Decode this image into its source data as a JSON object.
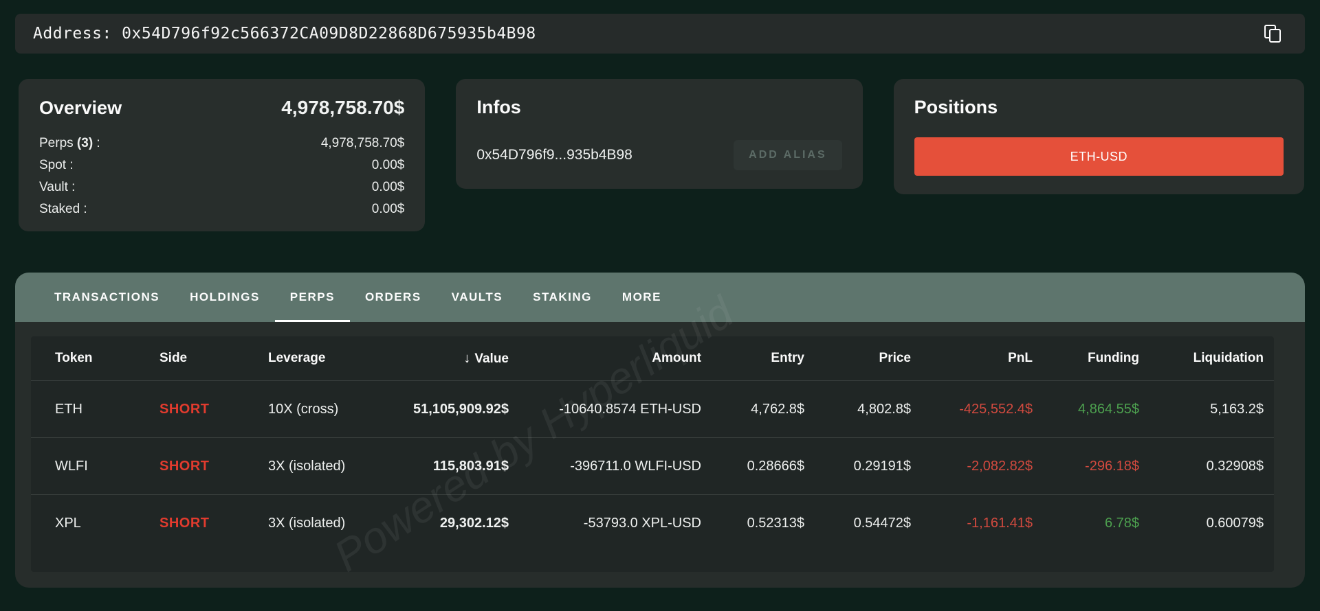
{
  "address_bar": {
    "text": "Address: 0x54D796f92c566372CA09D8D22868D675935b4B98"
  },
  "overview": {
    "title": "Overview",
    "total": "4,978,758.70$",
    "rows": [
      {
        "label": "Perps",
        "badge": "(3)",
        "suffix": " :",
        "value": "4,978,758.70$"
      },
      {
        "label": "Spot",
        "badge": "",
        "suffix": " :",
        "value": "0.00$"
      },
      {
        "label": "Vault",
        "badge": "",
        "suffix": " :",
        "value": "0.00$"
      },
      {
        "label": "Staked",
        "badge": "",
        "suffix": " :",
        "value": "0.00$"
      }
    ]
  },
  "infos": {
    "title": "Infos",
    "short_address": "0x54D796f9...935b4B98",
    "add_alias_label": "ADD ALIAS"
  },
  "positions": {
    "title": "Positions",
    "buttons": [
      {
        "label": "ETH-USD"
      }
    ]
  },
  "tabs": [
    {
      "label": "TRANSACTIONS",
      "active": false
    },
    {
      "label": "HOLDINGS",
      "active": false
    },
    {
      "label": "PERPS",
      "active": true
    },
    {
      "label": "ORDERS",
      "active": false
    },
    {
      "label": "VAULTS",
      "active": false
    },
    {
      "label": "STAKING",
      "active": false
    },
    {
      "label": "MORE",
      "active": false
    }
  ],
  "table": {
    "sort_icon": "↓",
    "columns": [
      "Token",
      "Side",
      "Leverage",
      "Value",
      "Amount",
      "Entry",
      "Price",
      "PnL",
      "Funding",
      "Liquidation"
    ],
    "rows": [
      {
        "token": "ETH",
        "side": "SHORT",
        "leverage": "10X (cross)",
        "value": "51,105,909.92$",
        "amount": "-10640.8574 ETH-USD",
        "entry": "4,762.8$",
        "price": "4,802.8$",
        "pnl": "-425,552.4$",
        "funding": "4,864.55$",
        "liquidation": "5,163.2$"
      },
      {
        "token": "WLFI",
        "side": "SHORT",
        "leverage": "3X (isolated)",
        "value": "115,803.91$",
        "amount": "-396711.0 WLFI-USD",
        "entry": "0.28666$",
        "price": "0.29191$",
        "pnl": "-2,082.82$",
        "funding": "-296.18$",
        "liquidation": "0.32908$"
      },
      {
        "token": "XPL",
        "side": "SHORT",
        "leverage": "3X (isolated)",
        "value": "29,302.12$",
        "amount": "-53793.0 XPL-USD",
        "entry": "0.52313$",
        "price": "0.54472$",
        "pnl": "-1,161.41$",
        "funding": "6.78$",
        "liquidation": "0.60079$"
      }
    ]
  },
  "watermark": "Powered by Hyperliquid",
  "colors": {
    "page_bg": "#0d201b",
    "card_bg": "#282e2c",
    "tabbar_bg": "#5e756d",
    "table_bg": "#202625",
    "accent_red": "#e5503a",
    "short_red": "#e23b2e",
    "pnl_negative": "#d24a3f",
    "value_positive": "#4da14f"
  }
}
